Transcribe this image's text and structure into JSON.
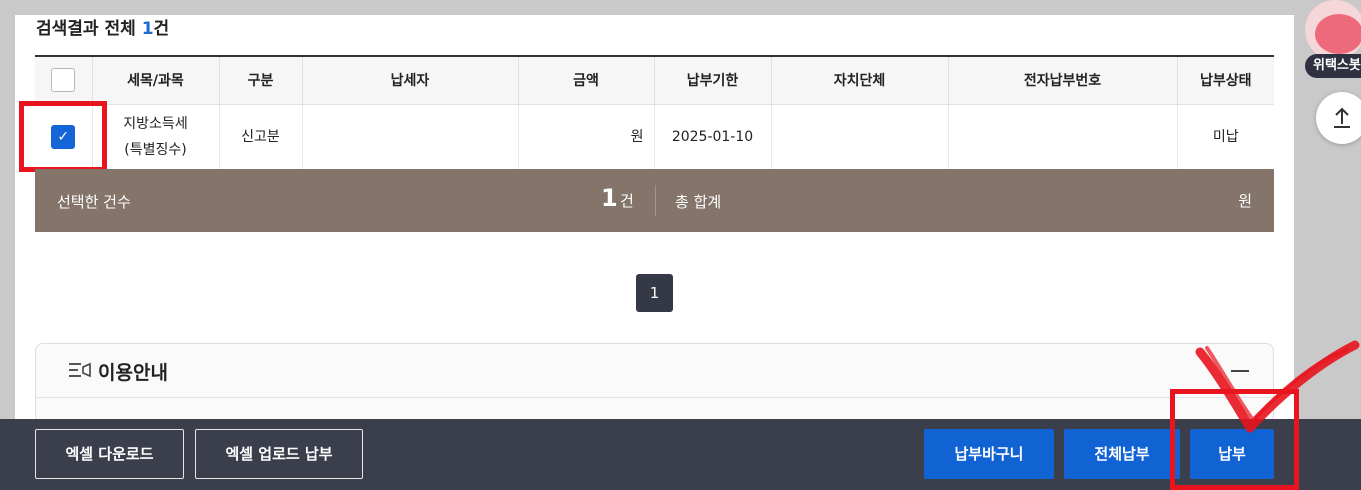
{
  "result": {
    "prefix": "검색결과 전체",
    "count": "1",
    "suffix": "건"
  },
  "table": {
    "headers": [
      "세목/과목",
      "구분",
      "납세자",
      "금액",
      "납부기한",
      "자치단체",
      "전자납부번호",
      "납부상태"
    ],
    "row": {
      "tax_line1": "지방소득세",
      "tax_line2": "(특별징수)",
      "type": "신고분",
      "taxpayer": "",
      "amount": "원",
      "due_date": "2025-01-10",
      "local_gov": "",
      "epay_no": "",
      "status": "미납"
    }
  },
  "summary": {
    "selected_label": "선택한 건수",
    "selected_count": "1",
    "selected_unit": "건",
    "total_label": "총 합계",
    "total_unit": "원"
  },
  "pagination": {
    "current": "1"
  },
  "guide": {
    "title": "이용안내"
  },
  "bottom": {
    "excel_download": "엑셀 다운로드",
    "excel_upload_pay": "엑셀 업로드 납부",
    "cart": "납부바구니",
    "pay_all": "전체납부",
    "pay": "납부"
  },
  "side": {
    "mascot_label": "위택스봇"
  },
  "icons": {
    "checkbox_checked": "check-icon",
    "guide": "list-icon",
    "collapse": "minus-icon",
    "scroll_top": "arrow-up-icon"
  },
  "colors": {
    "accent_blue": "#1162d3",
    "summary_bg": "#84746a",
    "highlight_red": "#e8141e",
    "bottom_bar": "#3b3e4b"
  }
}
